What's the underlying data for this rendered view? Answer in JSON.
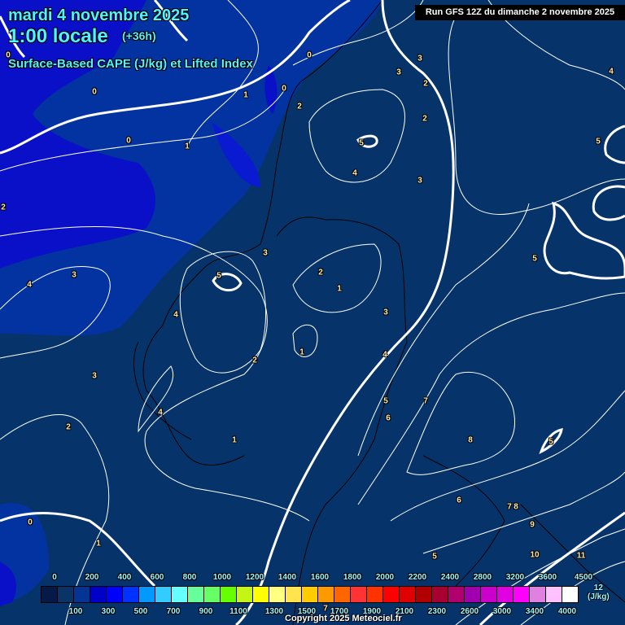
{
  "header": {
    "date": "mardi 4 novembre 2025",
    "time": "1:00 locale",
    "lead": "(+36h)",
    "parameter": "Surface-Based CAPE (J/kg) et Lifted Index",
    "run": "Run GFS 12Z du dimanche 2 novembre 2025"
  },
  "contour_labels": [
    "0",
    "0",
    "0",
    "1",
    "2",
    "1",
    "0",
    "0",
    "2",
    "3",
    "3",
    "2",
    "2",
    "4",
    "5",
    "4",
    "3",
    "5",
    "5",
    "3",
    "5",
    "2",
    "1",
    "3",
    "4",
    "4",
    "3",
    "1",
    "4",
    "2",
    "3",
    "5",
    "7",
    "6",
    "4",
    "2",
    "1",
    "8",
    "5",
    "6",
    "7",
    "8",
    "9",
    "0",
    "1",
    "5",
    "10",
    "11",
    "7"
  ],
  "legend": {
    "colors": [
      "#061a48",
      "#0a3466",
      "#043494",
      "#0000c8",
      "#0000ff",
      "#0033ff",
      "#0099ff",
      "#33ccff",
      "#66ffff",
      "#66ff99",
      "#66ff66",
      "#66ff00",
      "#c4f514",
      "#ffff00",
      "#ffff80",
      "#ffe44d",
      "#ffcc00",
      "#ff9900",
      "#ff6600",
      "#ff3333",
      "#ff3300",
      "#ff0000",
      "#e00000",
      "#b00000",
      "#a80030",
      "#b0006e",
      "#a000b0",
      "#cc00cc",
      "#e000e0",
      "#ff00ff",
      "#e080e0",
      "#ffc0ff",
      "#ffffff"
    ],
    "top_ticks": [
      "0",
      "200",
      "400",
      "600",
      "800",
      "1000",
      "1200",
      "1400",
      "1600",
      "1800",
      "2000",
      "2200",
      "2400",
      "2800",
      "3200",
      "3600",
      "4500"
    ],
    "bottom_ticks": [
      "100",
      "300",
      "500",
      "700",
      "900",
      "1100",
      "1300",
      "1500",
      "1700",
      "1900",
      "2100",
      "2300",
      "2600",
      "3000",
      "3400",
      "4000"
    ],
    "max": "12",
    "unit": "(J/kg)"
  },
  "copyright": "Copyright 2025 Meteociel.fr"
}
